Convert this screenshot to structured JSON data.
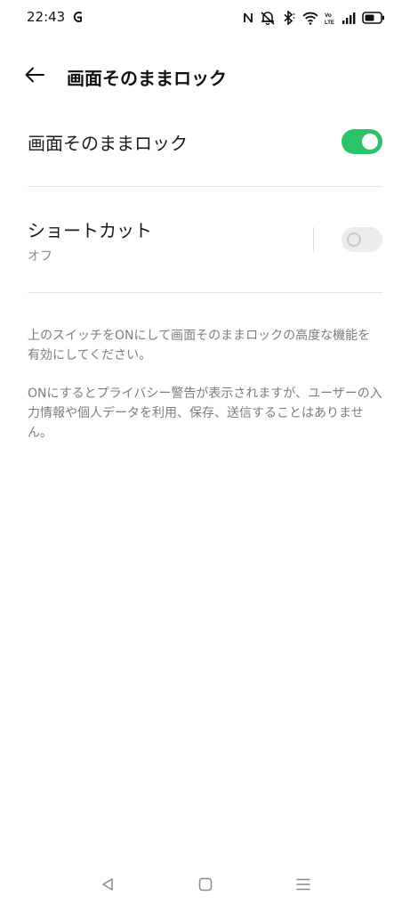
{
  "status_bar": {
    "time": "22:43",
    "icons": [
      "app-notification-icon",
      "nfc-icon",
      "mute-icon",
      "bluetooth-icon",
      "wifi-icon",
      "volte-icon",
      "signal-icon",
      "battery-icon"
    ],
    "volte_text": "Vo\nLTE"
  },
  "header": {
    "title": "画面そのままロック",
    "back_icon": "arrow-left-icon"
  },
  "settings": {
    "main_toggle": {
      "label": "画面そのままロック",
      "state": "on"
    },
    "shortcut": {
      "label": "ショートカット",
      "sublabel": "オフ",
      "state": "off"
    }
  },
  "description": {
    "paragraph_1": "上のスイッチをONにして画面そのままロックの高度な機能を有効にしてください。",
    "paragraph_2": "ONにするとプライバシー警告が表示されますが、ユーザーの入力情報や個人データを利用、保存、送信することはありません。"
  },
  "nav_bar": {
    "buttons": [
      "back-triangle-icon",
      "home-square-icon",
      "recents-menu-icon"
    ]
  },
  "colors": {
    "toggle_on": "#2cc46a",
    "toggle_off": "#ececec",
    "secondary_text": "#7d7d7d"
  }
}
